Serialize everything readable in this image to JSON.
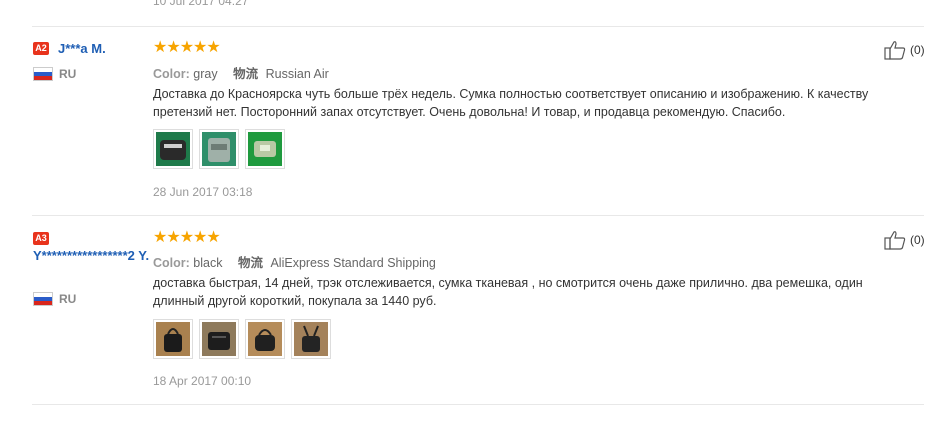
{
  "top_date": "10 Jul 2017 04:27",
  "labels": {
    "color": "Color:",
    "shipping": "物流"
  },
  "reviews": [
    {
      "badge": "A2",
      "name": "J***a M.",
      "country": "RU",
      "color_value": "gray",
      "shipping_value": "Russian Air",
      "text": "Доставка до Красноярска чуть больше трёх недель. Сумка полностью соответствует описанию и изображению. К качеству претензий нет. Посторонний запах отсутствует. Очень довольна! И товар, и продавца рекомендую. Спасибо.",
      "date": "28 Jun 2017 03:18",
      "helpful": "(0)"
    },
    {
      "badge": "A3",
      "name": "Y*****************2 Y.",
      "country": "RU",
      "color_value": "black",
      "shipping_value": "AliExpress Standard Shipping",
      "text": "доставка быстрая, 14 дней, трэк отслеживается, сумка тканевая , но смотрится очень даже прилично. два ремешка, один длинный другой короткий, покупала за 1440 руб.",
      "date": "18 Apr 2017 00:10",
      "helpful": "(0)"
    }
  ]
}
